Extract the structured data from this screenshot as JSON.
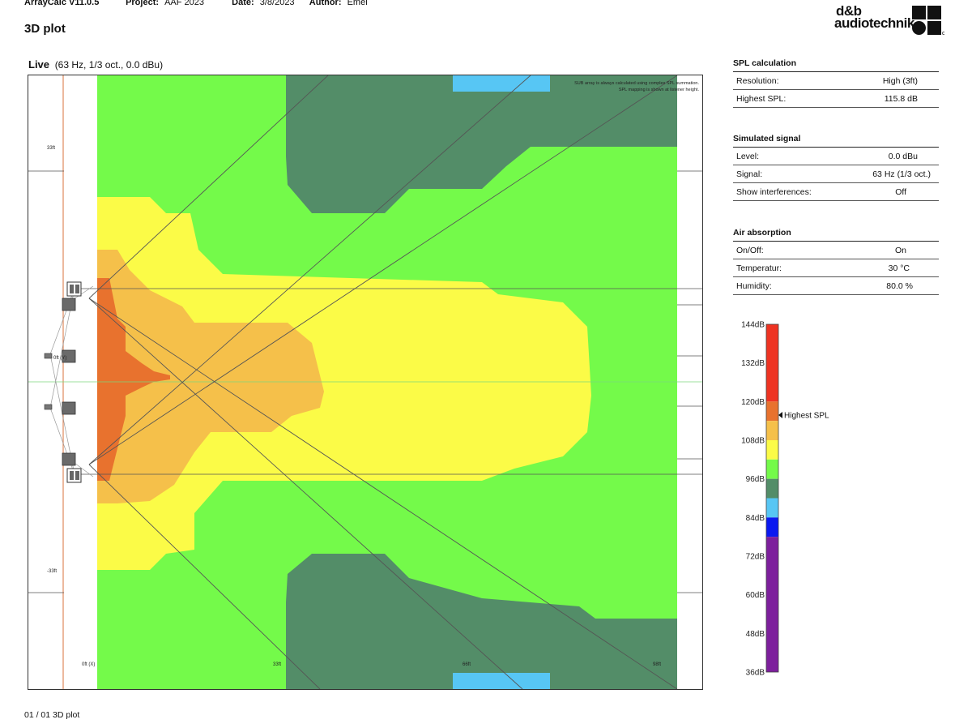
{
  "header": {
    "app": "ArrayCalc V11.0.5",
    "project_label": "Project:",
    "project": "AAF 2023",
    "date_label": "Date:",
    "date": "3/8/2023",
    "author_label": "Author:",
    "author": "Emei"
  },
  "page_title": "3D plot",
  "logo": {
    "line1": "d&b",
    "line2": "audiotechnik"
  },
  "plot": {
    "title_bold": "Live",
    "title_rest": "(63 Hz, 1/3 oct., 0.0 dBu)",
    "note_line1": "SUB array is always calculated using complex SPL summation.",
    "note_line2": "SPL mapping is shown at listener height.",
    "y_labels": [
      "33ft",
      "-33ft"
    ],
    "x_labels": [
      "0ft (X)",
      "33ft",
      "66ft",
      "98ft"
    ],
    "y_mid_label": "0ft (Y)"
  },
  "spl_calculation": {
    "heading": "SPL calculation",
    "rows": [
      {
        "key": "Resolution:",
        "value": "High (3ft)"
      },
      {
        "key": "Highest SPL:",
        "value": "115.8 dB"
      }
    ]
  },
  "simulated_signal": {
    "heading": "Simulated signal",
    "rows": [
      {
        "key": "Level:",
        "value": "0.0 dBu"
      },
      {
        "key": "Signal:",
        "value": "63 Hz (1/3 oct.)"
      },
      {
        "key": "Show interferences:",
        "value": "Off"
      }
    ]
  },
  "air_absorption": {
    "heading": "Air absorption",
    "rows": [
      {
        "key": "On/Off:",
        "value": "On"
      },
      {
        "key": "Temperatur:",
        "value": "30 °C"
      },
      {
        "key": "Humidity:",
        "value": "80.0 %"
      }
    ]
  },
  "color_scale": {
    "labels": [
      "144dB",
      "132dB",
      "120dB",
      "108dB",
      "96dB",
      "84dB",
      "72dB",
      "60dB",
      "48dB",
      "36dB"
    ],
    "marker_label": "Highest SPL",
    "marker_value_db": 115.8,
    "colors": {
      "red": "#ee3322",
      "dark_orange": "#e8722e",
      "light_orange": "#f5c04a",
      "yellow": "#fbfb47",
      "green": "#74fa4a",
      "dark_green": "#538d68",
      "light_blue": "#57c6f4",
      "blue": "#0a18f0",
      "purple": "#7d1f9c"
    }
  },
  "footer": "01 / 01 3D plot"
}
